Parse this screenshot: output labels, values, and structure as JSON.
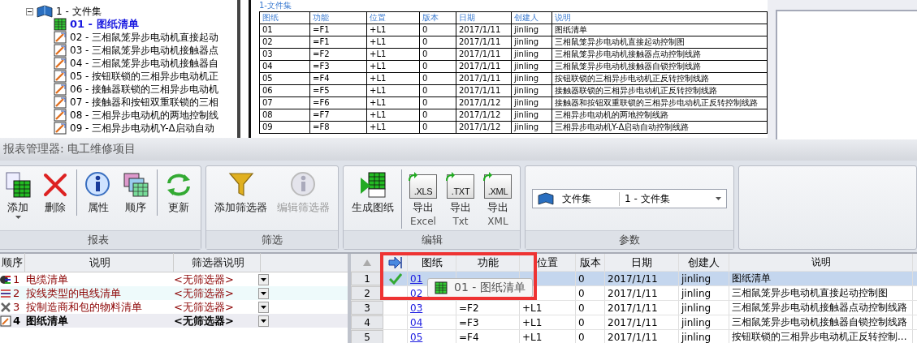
{
  "tree": {
    "root": {
      "label": "1 - 文件集",
      "expanded": true,
      "children": [
        {
          "label": "01 - 图纸清单",
          "kind": "list",
          "selected": true
        },
        {
          "label": "02 - 三相鼠笼异步电动机直接起动",
          "kind": "drawing",
          "selected": false
        },
        {
          "label": "03 - 三相鼠笼异步电动机接触器点",
          "kind": "drawing",
          "selected": false
        },
        {
          "label": "04 - 三相鼠笼异步电动机接触器自",
          "kind": "drawing",
          "selected": false
        },
        {
          "label": "05 - 按钮联锁的三相异步电动机正",
          "kind": "drawing",
          "selected": false
        },
        {
          "label": "06 - 接触器联锁的三相异步电动机",
          "kind": "drawing",
          "selected": false
        },
        {
          "label": "07 - 接触器和按钮双重联锁的三相",
          "kind": "drawing",
          "selected": false
        },
        {
          "label": "08 - 三相异步电动机的两地控制线",
          "kind": "drawing",
          "selected": false
        },
        {
          "label": "09 - 三相异步电动机Y-Δ启动自动",
          "kind": "drawing",
          "selected": false
        }
      ]
    }
  },
  "preview": {
    "heading": "1-文件集",
    "columns": [
      "图纸",
      "功能",
      "位置",
      "版本",
      "日期",
      "创建人",
      "说明"
    ],
    "rows": [
      [
        "01",
        "=F1",
        "+L1",
        "0",
        "2017/1/11",
        "jinling",
        "图纸清单"
      ],
      [
        "02",
        "=F1",
        "+L1",
        "0",
        "2017/1/11",
        "jinling",
        "三相鼠笼异步电动机直接起动控制图"
      ],
      [
        "03",
        "=F2",
        "+L1",
        "0",
        "2017/1/11",
        "jinling",
        "三相鼠笼异步电动机接触器点动控制线路"
      ],
      [
        "04",
        "=F3",
        "+L1",
        "0",
        "2017/1/11",
        "jinling",
        "三相鼠笼异步电动机接触器自锁控制线路"
      ],
      [
        "05",
        "=F4",
        "+L1",
        "0",
        "2017/1/11",
        "jinling",
        "按钮联锁的三相异步电动机正反转控制线路"
      ],
      [
        "06",
        "=F5",
        "+L1",
        "0",
        "2017/1/11",
        "jinling",
        "接触器联锁的三相异步电动机正反转控制线路"
      ],
      [
        "07",
        "=F6",
        "+L1",
        "0",
        "2017/1/12",
        "jinling",
        "接触器和按钮双重联锁的三相异步电动机正反转控制线路"
      ],
      [
        "08",
        "=F7",
        "+L1",
        "0",
        "2017/1/12",
        "jinling",
        "三相异步电动机的两地控制线路"
      ],
      [
        "09",
        "=F8",
        "+L1",
        "0",
        "2017/1/12",
        "jinling",
        "三相异步电动机Y-Δ启动自动控制线路"
      ]
    ]
  },
  "manager": {
    "title": "报表管理器: 电工维修项目",
    "groups": [
      {
        "label": "报表",
        "kind": "buttons",
        "buttons": [
          {
            "label": "添加",
            "kind": "add",
            "dropdown": true,
            "disabled": false,
            "separator": false
          },
          {
            "label": "删除",
            "kind": "delete",
            "dropdown": false,
            "disabled": false,
            "separator": false
          },
          {
            "label": "属性",
            "kind": "info",
            "dropdown": false,
            "disabled": false,
            "separator": true
          },
          {
            "label": "顺序",
            "kind": "order",
            "dropdown": false,
            "disabled": false,
            "separator": false
          },
          {
            "label": "更新",
            "kind": "refresh",
            "dropdown": false,
            "disabled": false,
            "separator": true
          }
        ]
      },
      {
        "label": "筛选",
        "kind": "buttons",
        "buttons": [
          {
            "label": "添加筛选器",
            "kind": "filter",
            "dropdown": false,
            "disabled": false,
            "separator": false
          },
          {
            "label": "编辑筛选器",
            "kind": "info",
            "dropdown": false,
            "disabled": true,
            "separator": false
          }
        ]
      },
      {
        "label": "编辑",
        "kind": "buttons",
        "buttons": [
          {
            "label": "生成图纸",
            "kind": "generate",
            "dropdown": false,
            "disabled": false,
            "separator": false
          },
          {
            "label": "导出",
            "sublabel": "Excel",
            "kind": "export",
            "icon_text": ".XLS",
            "dropdown": false,
            "disabled": false,
            "separator": true
          },
          {
            "label": "导出",
            "sublabel": "Txt",
            "kind": "export",
            "icon_text": ".TXT",
            "dropdown": false,
            "disabled": false,
            "separator": false
          },
          {
            "label": "导出",
            "sublabel": "XML",
            "kind": "export",
            "icon_text": ".XML",
            "dropdown": false,
            "disabled": false,
            "separator": false
          }
        ]
      },
      {
        "label": "参数",
        "kind": "param",
        "field_label": "文件集",
        "value": "1 - 文件集"
      }
    ]
  },
  "reports": {
    "columns": [
      "顺序",
      "说明",
      "筛选器说明"
    ],
    "rows": [
      {
        "order": "1",
        "kind": "cable",
        "name": "电缆清单",
        "filter": "<无筛选器>",
        "selected": false
      },
      {
        "order": "2",
        "kind": "wires",
        "name": "按线类型的电线清单",
        "filter": "<无筛选器>",
        "selected": false
      },
      {
        "order": "3",
        "kind": "tools",
        "name": "按制造商和包的物料清单",
        "filter": "<无筛选器>",
        "selected": false
      },
      {
        "order": "4",
        "kind": "drawing",
        "name": "图纸清单",
        "filter": "<无筛选器>",
        "selected": true
      }
    ]
  },
  "grid": {
    "columns": [
      "图纸",
      "功能",
      "位置",
      "版本",
      "日期",
      "创建人",
      "说明"
    ],
    "rows": [
      {
        "number": "1",
        "checked": true,
        "selected": true,
        "cells": [
          "01",
          null,
          null,
          "0",
          "2017/1/11",
          "jinling",
          "图纸清单"
        ]
      },
      {
        "number": "2",
        "checked": false,
        "selected": false,
        "cells": [
          "02",
          null,
          null,
          "0",
          "2017/1/11",
          "jinling",
          "三相鼠笼异步电动机直接起动控制图"
        ]
      },
      {
        "number": "3",
        "checked": false,
        "selected": false,
        "cells": [
          "03",
          "=F2",
          "+L1",
          "0",
          "2017/1/11",
          "jinling",
          "三相鼠笼异步电动机接触器点动控制线路"
        ]
      },
      {
        "number": "4",
        "checked": false,
        "selected": false,
        "cells": [
          "04",
          "=F3",
          "+L1",
          "0",
          "2017/1/11",
          "jinling",
          "三相鼠笼异步电动机接触器自锁控制线路"
        ]
      },
      {
        "number": "5",
        "checked": false,
        "selected": false,
        "cells": [
          "05",
          "=F4",
          "+L1",
          "0",
          "2017/1/11",
          "jinling",
          "按钮联锁的三相异步电动机正反转控制..."
        ]
      }
    ]
  },
  "tooltip": {
    "text": "01 - 图纸清单"
  }
}
